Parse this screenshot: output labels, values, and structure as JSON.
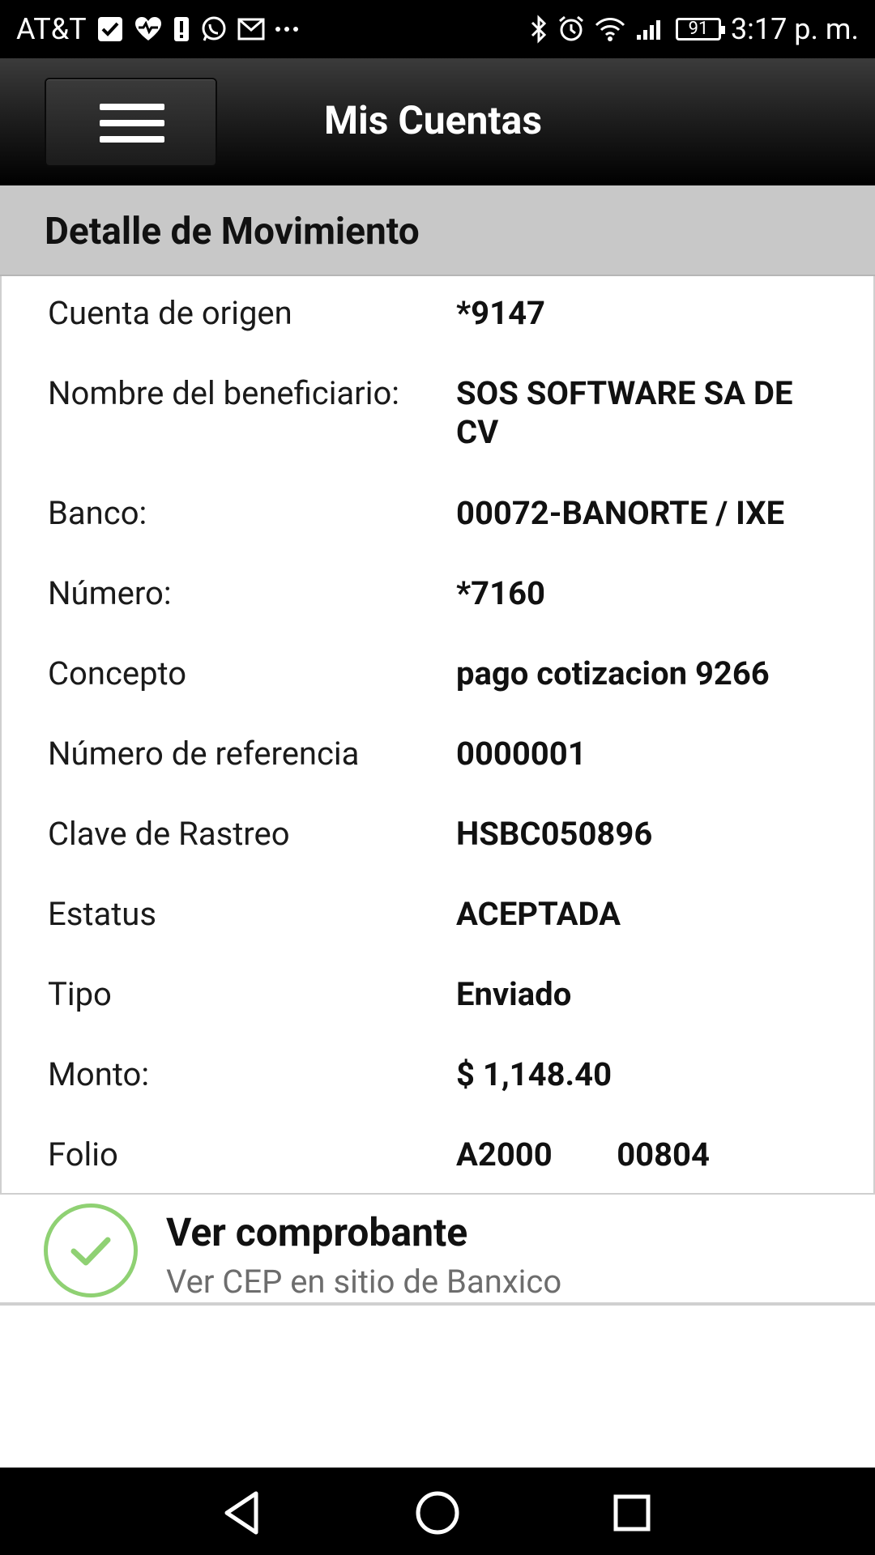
{
  "status_bar": {
    "carrier": "AT&T",
    "battery": "91",
    "time": "3:17 p. m."
  },
  "app_bar": {
    "title": "Mis Cuentas"
  },
  "section": {
    "title": "Detalle de Movimiento"
  },
  "details": [
    {
      "label": "Cuenta de origen",
      "value": "*9147"
    },
    {
      "label": "Nombre del beneficiario:",
      "value": "SOS SOFTWARE SA DE CV"
    },
    {
      "label": "Banco:",
      "value": "00072-BANORTE / IXE"
    },
    {
      "label": "Número:",
      "value": "*7160"
    },
    {
      "label": "Concepto",
      "value": "pago cotizacion 9266"
    },
    {
      "label": "Número de referencia",
      "value": "0000001"
    },
    {
      "label": "Clave de Rastreo",
      "value": "HSBC050896"
    },
    {
      "label": "Estatus",
      "value": "ACEPTADA"
    },
    {
      "label": "Tipo",
      "value": "Enviado"
    },
    {
      "label": "Monto:",
      "value": "$ 1,148.40"
    },
    {
      "label": "Folio",
      "value": "A2000        00804"
    }
  ],
  "cep_link": {
    "title": "Ver comprobante",
    "subtitle": "Ver CEP en sitio de Banxico",
    "icon": "check-circle-icon",
    "accent": "#8fd173"
  },
  "nav": {
    "icons": [
      "back-icon",
      "home-icon",
      "recents-icon"
    ]
  }
}
